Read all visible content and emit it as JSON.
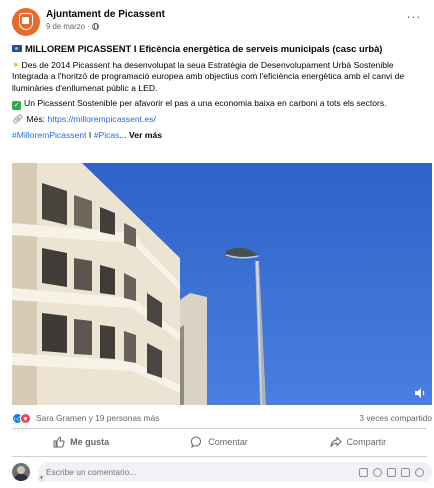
{
  "page": {
    "name": "Ajuntament de Picassent",
    "date": "9 de marzo",
    "meta_separator": "·",
    "more": "···"
  },
  "post": {
    "title": "MILLOREM PICASSENT I Eficència energètica de serveis municipals (casc urbà)",
    "paragraph1": "Des de 2014 Picassent ha desenvolupat la seua Estratègia de Desenvolupament Urbà Sostenible Integrada a l'horitzó de programació europea amb objectius com l'eficiència energètica amb el canvi de lluminàries d'enllumenat públic a LED.",
    "paragraph2": "Un Picassent Sostenible per afavorir el pas a una economia baixa en carboni a tots els sectors.",
    "more_label": "Més: ",
    "more_link": "https://millorempicassent.es/",
    "hashtag1": "#MilloremPicassent",
    "hashtag_sep": " I ",
    "hashtag2": "#Picas",
    "ellipsis": "...",
    "see_more": "Ver más"
  },
  "reactions": {
    "summary": "Sara Gramen y 19 personas más",
    "shares": "3 veces compartido"
  },
  "actions": {
    "like": "Me gusta",
    "comment": "Comentar",
    "share": "Compartir"
  },
  "composer": {
    "placeholder": "Escribe un comentario..."
  },
  "colors": {
    "link": "#216fdb",
    "like": "#1877f2",
    "love": "#f33e58",
    "avatar": "#e76b2b"
  }
}
